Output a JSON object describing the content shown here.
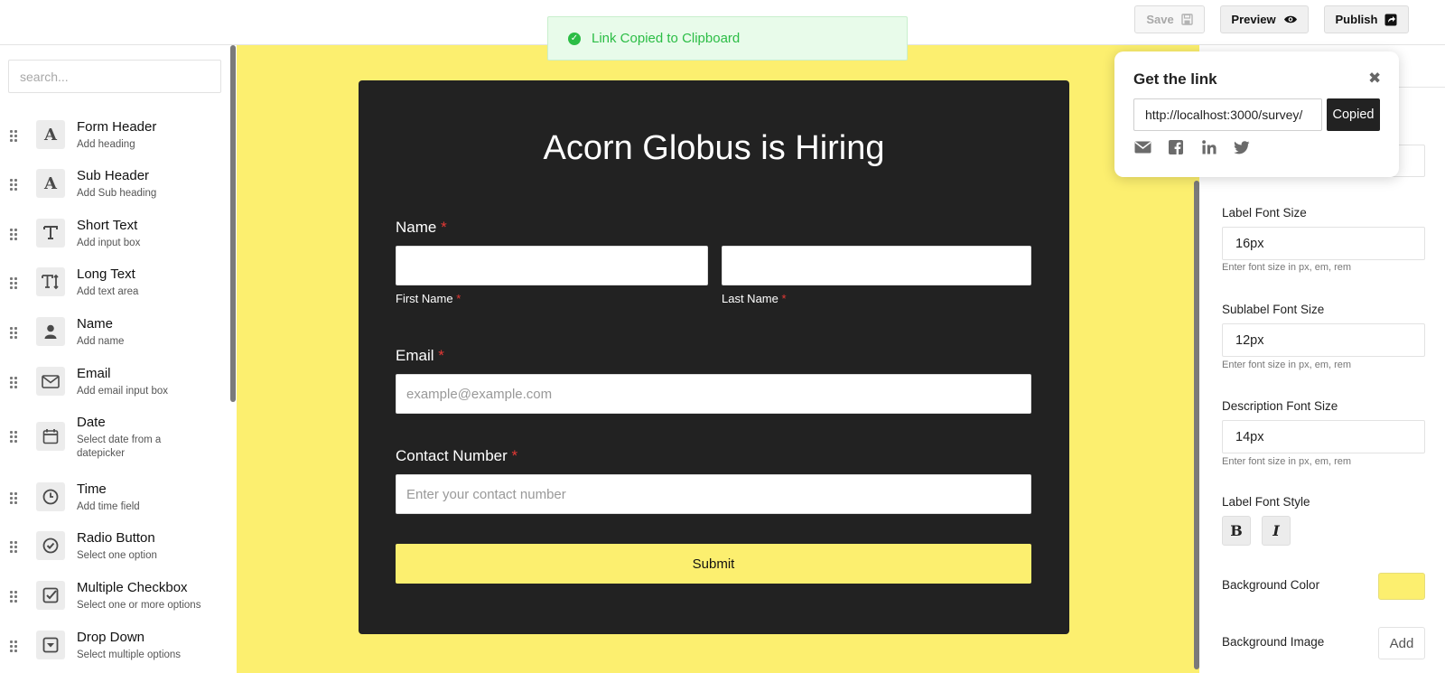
{
  "toolbar": {
    "save_label": "Save",
    "preview_label": "Preview",
    "publish_label": "Publish"
  },
  "toast": {
    "message": "Link Copied to Clipboard"
  },
  "sidebar": {
    "search_placeholder": "search...",
    "items": [
      {
        "title": "Form Header",
        "subtitle": "Add heading",
        "icon": "text-icon"
      },
      {
        "title": "Sub Header",
        "subtitle": "Add Sub heading",
        "icon": "text-icon"
      },
      {
        "title": "Short Text",
        "subtitle": "Add input box",
        "icon": "short-text-icon"
      },
      {
        "title": "Long Text",
        "subtitle": "Add text area",
        "icon": "long-text-icon"
      },
      {
        "title": "Name",
        "subtitle": "Add name",
        "icon": "user-icon"
      },
      {
        "title": "Email",
        "subtitle": "Add email input box",
        "icon": "envelope-icon"
      },
      {
        "title": "Date",
        "subtitle": "Select date from a datepicker",
        "icon": "calendar-icon"
      },
      {
        "title": "Time",
        "subtitle": "Add time field",
        "icon": "clock-icon"
      },
      {
        "title": "Radio Button",
        "subtitle": "Select one option",
        "icon": "radio-check-icon"
      },
      {
        "title": "Multiple Checkbox",
        "subtitle": "Select one or more options",
        "icon": "checkbox-icon"
      },
      {
        "title": "Drop Down",
        "subtitle": "Select multiple options",
        "icon": "dropdown-icon"
      }
    ]
  },
  "form": {
    "title": "Acorn Globus is Hiring",
    "name_label": "Name",
    "first_name_sublabel": "First Name",
    "last_name_sublabel": "Last Name",
    "email_label": "Email",
    "email_placeholder": "example@example.com",
    "contact_label": "Contact Number",
    "contact_placeholder": "Enter your contact number",
    "submit_label": "Submit",
    "required_mark": "*"
  },
  "right_panel": {
    "label_font_size": {
      "label": "Label Font Size",
      "value": "16px",
      "hint": "Enter font size in px, em, rem"
    },
    "sublabel_font_size": {
      "label": "Sublabel Font Size",
      "value": "12px",
      "hint": "Enter font size in px, em, rem"
    },
    "description_font_size": {
      "label": "Description Font Size",
      "value": "14px",
      "hint": "Enter font size in px, em, rem"
    },
    "label_font_style": {
      "label": "Label Font Style",
      "bold": "B",
      "italic": "I"
    },
    "background_color": {
      "label": "Background Color",
      "value": "#fcef6f"
    },
    "background_image": {
      "label": "Background Image",
      "button": "Add"
    }
  },
  "link_popover": {
    "title": "Get the link",
    "url": "http://localhost:3000/survey/",
    "copied_label": "Copied",
    "share_icons": [
      "envelope-icon",
      "facebook-icon",
      "linkedin-icon",
      "twitter-icon"
    ]
  },
  "colors": {
    "canvas_bg": "#fcef6f",
    "card_bg": "#222222",
    "toast_text": "#2bbd45",
    "required": "#e53935"
  }
}
